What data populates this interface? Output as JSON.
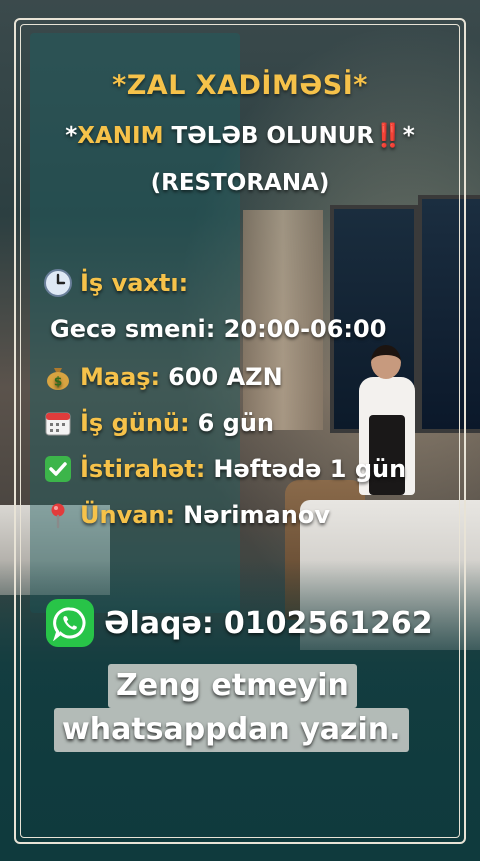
{
  "headline": "*ZAL XADİMƏSİ*",
  "subline": {
    "prefix": "*",
    "highlight": "XANIM",
    "text": " TƏLƏB OLUNUR",
    "marks": "‼️",
    "suffix": "*"
  },
  "subline2": "(RESTORANA)",
  "details": {
    "hours_label": "İş vaxtı:",
    "hours_value": "Gecə smeni: 20:00-06:00",
    "salary_label": "Maaş:",
    "salary_value": "600 AZN",
    "workdays_label": "İş günü:",
    "workdays_value": "6 gün",
    "rest_label": "İstirahət:",
    "rest_value": "Həftədə 1 gün",
    "address_label": "Ünvan:",
    "address_value": "Nərimanov"
  },
  "contact": {
    "label": "Əlaqə:",
    "phone": "0102561262"
  },
  "note": {
    "line1": "Zeng etmeyin",
    "line2": "whatsappdan yazin."
  },
  "icons": {
    "hours": "clock-icon",
    "salary": "money-bag-icon",
    "workdays": "calendar-icon",
    "rest": "check-mark-icon",
    "address": "location-pin-icon",
    "contact": "whatsapp-icon"
  },
  "colors": {
    "gold": "#f6c24a",
    "warning_red": "#e2262c",
    "whatsapp_green": "#28c448",
    "teal": "#1e5f62"
  }
}
